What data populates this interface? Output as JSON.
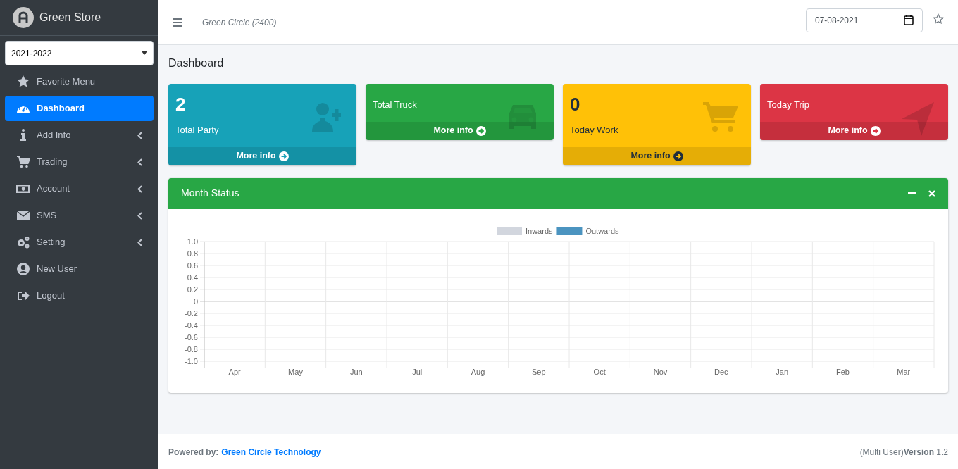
{
  "brand": {
    "title": "Green Store"
  },
  "year_select": {
    "value": "2021-2022"
  },
  "sidebar": {
    "items": [
      {
        "label": "Favorite Menu",
        "kind": "star",
        "selected": false,
        "has_submenu": false
      },
      {
        "label": "Dashboard",
        "kind": "gauge",
        "selected": true,
        "has_submenu": false
      },
      {
        "label": "Add Info",
        "kind": "info",
        "selected": false,
        "has_submenu": true
      },
      {
        "label": "Trading",
        "kind": "cart",
        "selected": false,
        "has_submenu": true
      },
      {
        "label": "Account",
        "kind": "money",
        "selected": false,
        "has_submenu": true
      },
      {
        "label": "SMS",
        "kind": "mail",
        "selected": false,
        "has_submenu": true
      },
      {
        "label": "Setting",
        "kind": "gears",
        "selected": false,
        "has_submenu": true
      },
      {
        "label": "New User",
        "kind": "user",
        "selected": false,
        "has_submenu": false
      },
      {
        "label": "Logout",
        "kind": "logout",
        "selected": false,
        "has_submenu": false
      }
    ]
  },
  "header": {
    "company": "Green Circle (2400)",
    "date": "07-08-2021"
  },
  "page_title": "Dashboard",
  "cards": [
    {
      "value": "2",
      "label": "Total Party",
      "link": "More info",
      "color": "#17a2b8",
      "kind": "user-plus"
    },
    {
      "label": "Total Truck",
      "link": "More info",
      "color": "#28a745",
      "kind": "car"
    },
    {
      "value": "0",
      "label": "Today Work",
      "link": "More info",
      "color": "#ffc107",
      "kind": "cart"
    },
    {
      "label": "Today Trip",
      "link": "More info",
      "color": "#dc3545",
      "kind": "send"
    }
  ],
  "month_status": {
    "title": "Month Status",
    "chart_data": {
      "type": "bar",
      "categories": [
        "Apr",
        "May",
        "Jun",
        "Jul",
        "Aug",
        "Sep",
        "Oct",
        "Nov",
        "Dec",
        "Jan",
        "Feb",
        "Mar"
      ],
      "series": [
        {
          "name": "Inwards",
          "color": "#d2d6de",
          "values": [
            0,
            0,
            0,
            0,
            0,
            0,
            0,
            0,
            0,
            0,
            0,
            0
          ]
        },
        {
          "name": "Outwards",
          "color": "#4b94c0",
          "values": [
            0,
            0,
            0,
            0,
            0,
            0,
            0,
            0,
            0,
            0,
            0,
            0
          ]
        }
      ],
      "ylim": [
        -1,
        1
      ],
      "grid": true,
      "yticks": [
        {
          "value": 1,
          "label": "1.0"
        },
        {
          "value": 0.8,
          "label": "0.8"
        },
        {
          "value": 0.6,
          "label": "0.6"
        },
        {
          "value": 0.4,
          "label": "0.4"
        },
        {
          "value": 0.2,
          "label": "0.2"
        },
        {
          "value": 0,
          "label": "0"
        },
        {
          "value": -0.2,
          "label": "-0.2"
        },
        {
          "value": -0.4,
          "label": "-0.4"
        },
        {
          "value": -0.6,
          "label": "-0.6"
        },
        {
          "value": -0.8,
          "label": "-0.8"
        },
        {
          "value": -1,
          "label": "-1.0"
        }
      ]
    }
  },
  "footer": {
    "label": "Powered by:",
    "link": "Green Circle Technology",
    "version": "(Multi User)**Version** 1.2"
  }
}
